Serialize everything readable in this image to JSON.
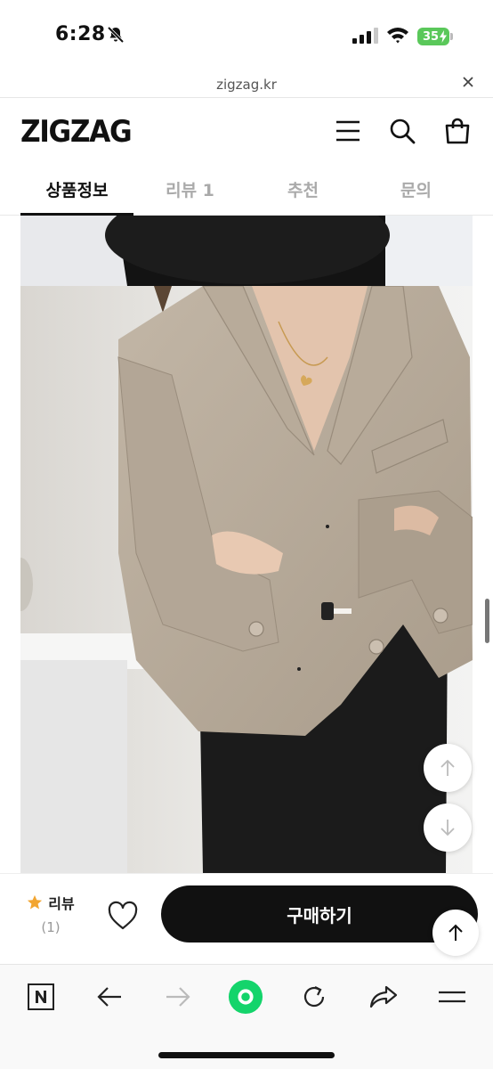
{
  "status_bar": {
    "time": "6:28",
    "battery": "35",
    "icons": [
      "bell-slash-icon",
      "signal-icon",
      "wifi-icon",
      "battery-icon"
    ]
  },
  "url_bar": {
    "url": "zigzag.kr",
    "close_icon": "close-icon"
  },
  "header": {
    "logo": "ZIGZAG",
    "icons": [
      "menu-icon",
      "search-icon",
      "cart-icon"
    ]
  },
  "tabs": [
    {
      "label": "상품정보",
      "active": true
    },
    {
      "label": "리뷰 1",
      "active": false
    },
    {
      "label": "추천",
      "active": false
    },
    {
      "label": "문의",
      "active": false
    }
  ],
  "content": {
    "image": "product-photo",
    "float_buttons": [
      "scroll-up-icon",
      "scroll-down-icon",
      "back-to-top-icon"
    ]
  },
  "purchase_bar": {
    "review_label": "리뷰",
    "review_count": "(1)",
    "buy_label": "구매하기",
    "accent_star_color": "#f2a531"
  },
  "browser_toolbar": {
    "icons": [
      "naver-n-icon",
      "back-arrow-icon",
      "forward-arrow-icon",
      "green-dot-icon",
      "refresh-icon",
      "share-icon",
      "menu-lines-icon"
    ],
    "green_color": "#14d46b"
  }
}
